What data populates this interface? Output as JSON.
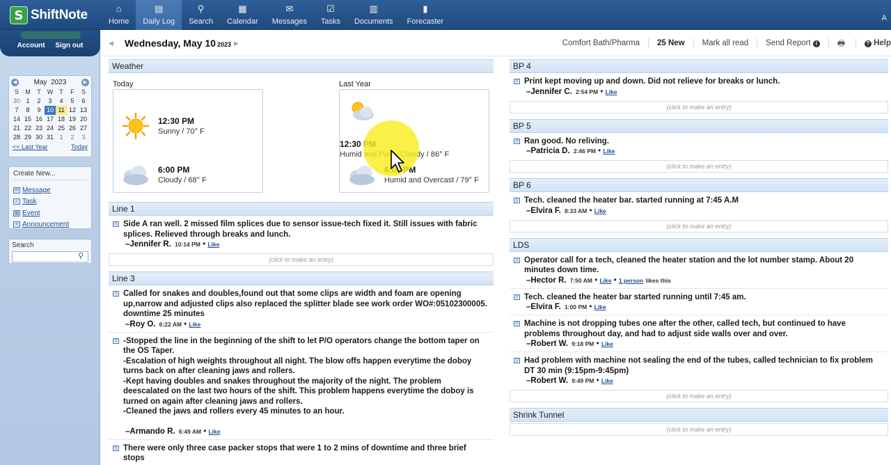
{
  "app": {
    "name": "ShiftNote"
  },
  "account": {
    "account_link": "Account",
    "signout_link": "Sign out"
  },
  "nav": {
    "items": [
      {
        "label": "Home",
        "icon": "home-icon"
      },
      {
        "label": "Daily Log",
        "icon": "log-icon",
        "active": true
      },
      {
        "label": "Search",
        "icon": "search-icon"
      },
      {
        "label": "Calendar",
        "icon": "calendar-icon"
      },
      {
        "label": "Messages",
        "icon": "messages-icon"
      },
      {
        "label": "Tasks",
        "icon": "tasks-icon"
      },
      {
        "label": "Documents",
        "icon": "documents-icon"
      },
      {
        "label": "Forecaster",
        "icon": "forecaster-icon"
      }
    ],
    "right_partial": "A"
  },
  "calendar": {
    "month": "May",
    "year": "2023",
    "dow": [
      "S",
      "M",
      "T",
      "W",
      "T",
      "F",
      "S"
    ],
    "weeks": [
      [
        "30",
        "1",
        "2",
        "3",
        "4",
        "5",
        "6"
      ],
      [
        "7",
        "8",
        "9",
        "10",
        "11",
        "12",
        "13"
      ],
      [
        "14",
        "15",
        "16",
        "17",
        "18",
        "19",
        "20"
      ],
      [
        "21",
        "22",
        "23",
        "24",
        "25",
        "26",
        "27"
      ],
      [
        "28",
        "29",
        "30",
        "31",
        "1",
        "2",
        "3"
      ]
    ],
    "selected_day": "10",
    "today_day": "11",
    "last_year_link": "<< Last Year",
    "today_link": "Today"
  },
  "create_new": {
    "title": "Create New...",
    "items": [
      {
        "label": "Message",
        "icon": "message-icon"
      },
      {
        "label": "Task",
        "icon": "task-icon"
      },
      {
        "label": "Event",
        "icon": "event-icon"
      },
      {
        "label": "Announcement",
        "icon": "announcement-icon"
      }
    ]
  },
  "search_box": {
    "title": "Search",
    "placeholder": ""
  },
  "datebar": {
    "date": "Wednesday, May 10",
    "year": "2023",
    "location": "Comfort Bath/Pharma",
    "new_count": "25 New",
    "mark_all_read": "Mark all read",
    "send_report": "Send Report",
    "help": "Help"
  },
  "weather": {
    "title": "Weather",
    "today_label": "Today",
    "last_year_label": "Last Year",
    "today": [
      {
        "time": "12:30 PM",
        "desc": "Sunny / 70° F",
        "icon": "sunny-icon"
      },
      {
        "time": "6:00 PM",
        "desc": "Cloudy / 68° F",
        "icon": "cloudy-icon"
      }
    ],
    "last_year": [
      {
        "time": "12:30 PM",
        "desc": "Humid and Partly Cloudy / 86° F",
        "icon": "partly-cloudy-icon"
      },
      {
        "time": "6:00 PM",
        "desc": "Humid and Overcast / 79° F",
        "icon": "overcast-icon"
      }
    ]
  },
  "click_prompt": "(click to make an entry)",
  "left_sections": [
    {
      "title": "Line 1",
      "entries": [
        {
          "lines": [
            "Side A ran well. 2 missed film splices due to sensor issue-tech fixed it. Still issues with fabric splices. Relieved through breaks and lunch."
          ],
          "author": "–Jennifer R.",
          "time": "10:14 PM",
          "like": "Like"
        }
      ]
    },
    {
      "title": "Line 3",
      "entries": [
        {
          "lines": [
            "Called for snakes and doubles,found out that some clips are width and foam are opening up,narrow and adjusted clips also replaced the splitter blade see work order WO#:05102300005. downtime 25 minutes"
          ],
          "author": "–Roy O.",
          "time": "6:22 AM",
          "like": "Like"
        },
        {
          "lines": [
            "-Stopped the line in the beginning of the shift to let P/O operators change the bottom taper on the OS Taper.",
            "-Escalation of high weights throughout all night. The blow offs happen everytime the doboy turns back on after cleaning jaws and rollers.",
            "-Kept having doubles and snakes throughout the majority of the night. The problem deescalated on the last two hours of the shift. This problem happens everytime the doboy is turned on again after cleaning jaws and rollers.",
            "-Cleaned the jaws and rollers every 45 minutes to an hour.",
            " "
          ],
          "author": "–Armando R.",
          "time": "6:49 AM",
          "like": "Like"
        },
        {
          "lines": [
            "There were only three case packer stops that were 1 to 2 mins of downtime and three brief stops"
          ],
          "author": "",
          "time": "",
          "like": ""
        }
      ]
    }
  ],
  "right_sections": [
    {
      "title": "BP 4",
      "entries": [
        {
          "lines": [
            "Print kept moving up and down. Did not relieve for breaks or lunch."
          ],
          "author": "–Jennifer C.",
          "time": "2:54 PM",
          "like": "Like"
        }
      ]
    },
    {
      "title": "BP 5",
      "entries": [
        {
          "lines": [
            "Ran good. No reliving."
          ],
          "author": "–Patricia D.",
          "time": "2:46 PM",
          "like": "Like"
        }
      ]
    },
    {
      "title": "BP 6",
      "entries": [
        {
          "lines": [
            "Tech. cleaned the heater bar. started running at 7:45 A.M"
          ],
          "author": "–Elvira F.",
          "time": "8:33 AM",
          "like": "Like"
        }
      ]
    },
    {
      "title": "LDS",
      "entries": [
        {
          "lines": [
            "Operator call for a tech, cleaned the heater station and the lot number stamp. About 20 minutes down time."
          ],
          "author": "–Hector R.",
          "time": "7:50 AM",
          "like": "Like",
          "likes_person": "1 person",
          "likes_suffix": "likes this"
        },
        {
          "lines": [
            "Tech. cleaned the heater bar started running until 7:45 am."
          ],
          "author": "–Elvira F.",
          "time": "1:00 PM",
          "like": "Like"
        },
        {
          "lines": [
            "Machine is not dropping tubes one after the other, called tech, but continued to have problems throughout day, and had to adjust side walls over and over."
          ],
          "author": "–Robert W.",
          "time": "9:18 PM",
          "like": "Like"
        },
        {
          "lines": [
            "Had problem with machine not sealing the end of the tubes, called technician to fix problem DT 30 min (9:15pm-9:45pm)"
          ],
          "author": "–Robert W.",
          "time": "9:49 PM",
          "like": "Like"
        }
      ]
    },
    {
      "title": "Shrink Tunnel",
      "entries": []
    }
  ]
}
